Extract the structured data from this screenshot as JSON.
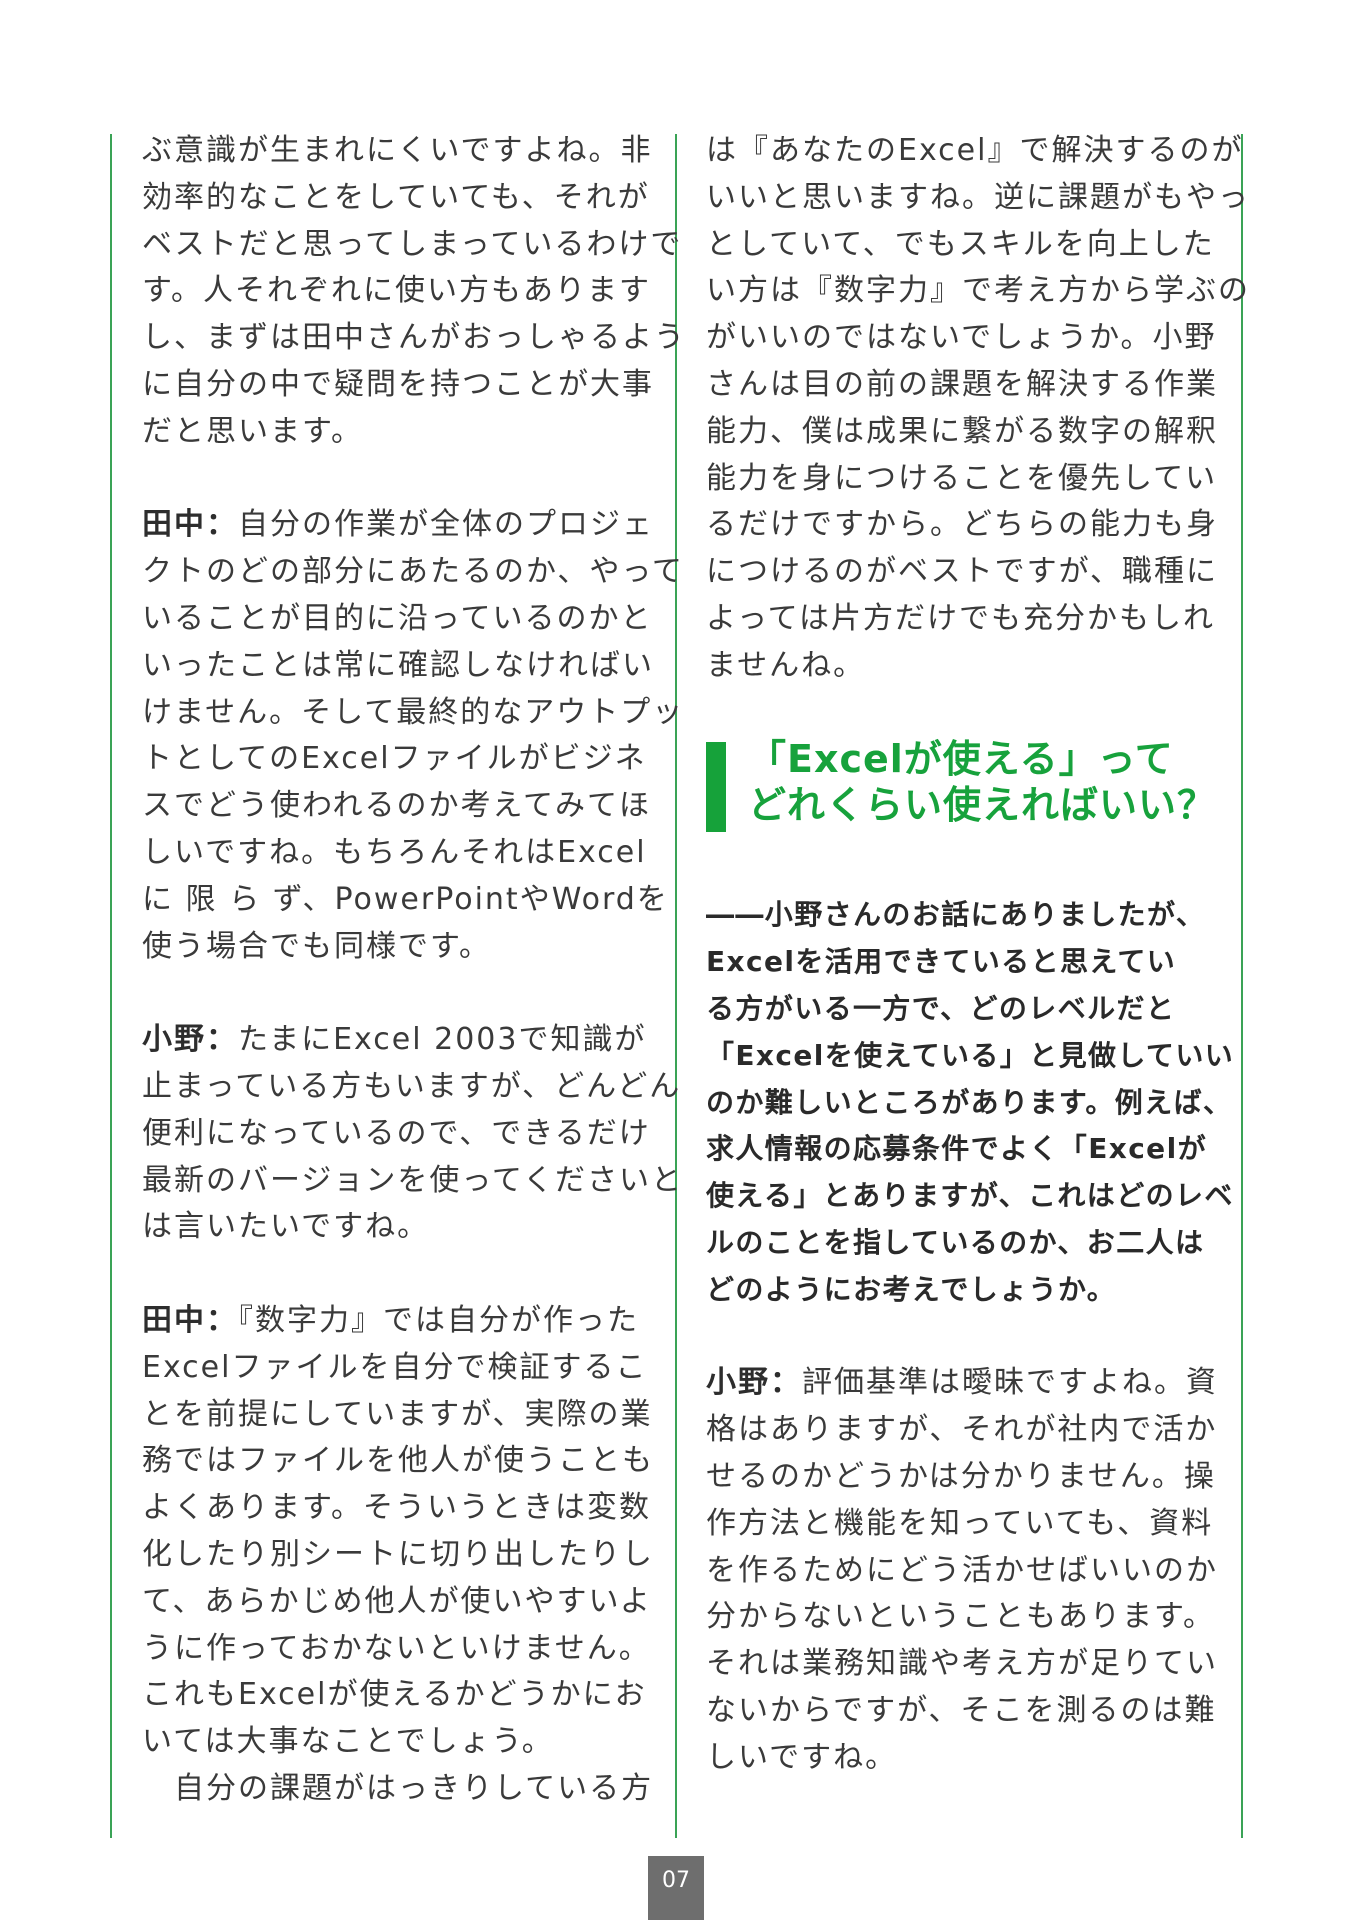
{
  "colors": {
    "accent_green": "#17a23c",
    "rule_green": "#3aa356",
    "page_number_bg": "#6e6e6e"
  },
  "left_column": {
    "p1": [
      "ぶ意識が生まれにくいですよね。非",
      "効率的なことをしていても、それが",
      "ベストだと思ってしまっているわけで",
      "す。人それぞれに使い方もあります",
      "し、まずは田中さんがおっしゃるよう",
      "に自分の中で疑問を持つことが大事",
      "だと思います。"
    ],
    "p2": {
      "speaker": "田中：",
      "first": "自分の作業が全体のプロジェ",
      "lines": [
        "クトのどの部分にあたるのか、やって",
        "いることが目的に沿っているのかと",
        "いったことは常に確認しなければい",
        "けません。そして最終的なアウトプッ",
        "トとしてのExcelファイルがビジネ",
        "スでどう使われるのか考えてみてほ",
        "しいですね。もちろんそれはExcel",
        "に 限 ら ず、PowerPointやWordを",
        "使う場合でも同様です。"
      ]
    },
    "p3": {
      "speaker": "小野：",
      "first": "たまにExcel 2003で知識が",
      "lines": [
        "止まっている方もいますが、どんどん",
        "便利になっているので、できるだけ",
        "最新のバージョンを使ってくださいと",
        "は言いたいですね。"
      ]
    },
    "p4": {
      "speaker": "田中：",
      "first": "『数字力』では自分が作った",
      "lines": [
        "Excelファイルを自分で検証するこ",
        "とを前提にしていますが、実際の業",
        "務ではファイルを他人が使うことも",
        "よくあります。そういうときは変数",
        "化したり別シートに切り出したりし",
        "て、あらかじめ他人が使いやすいよ",
        "うに作っておかないといけません。",
        "これもExcelが使えるかどうかにお",
        "いては大事なことでしょう。",
        "　自分の課題がはっきりしている方"
      ]
    }
  },
  "right_column": {
    "p1": [
      "は『あなたのExcel』で解決するのが",
      "いいと思いますね。逆に課題がもやっ",
      "としていて、でもスキルを向上した",
      "い方は『数字力』で考え方から学ぶの",
      "がいいのではないでしょうか。小野",
      "さんは目の前の課題を解決する作業",
      "能力、僕は成果に繋がる数字の解釈",
      "能力を身につけることを優先してい",
      "るだけですから。どちらの能力も身",
      "につけるのがベストですが、職種に",
      "よっては片方だけでも充分かもしれ",
      "ませんね。"
    ],
    "heading": {
      "line1": "「Excelが使える」って",
      "line2": "どれくらい使えればいい？"
    },
    "question": [
      "――小野さんのお話にありましたが、",
      "Excelを活用できていると思えてい",
      "る方がいる一方で、どのレベルだと",
      "「Excelを使えている」と見做していい",
      "のか難しいところがあります。例えば、",
      "求人情報の応募条件でよく「Excelが",
      "使える」とありますが、これはどのレベ",
      "ルのことを指しているのか、お二人は",
      "どのようにお考えでしょうか。"
    ],
    "p2": {
      "speaker": "小野：",
      "first": "評価基準は曖昧ですよね。資",
      "lines": [
        "格はありますが、それが社内で活か",
        "せるのかどうかは分かりません。操",
        "作方法と機能を知っていても、資料",
        "を作るためにどう活かせばいいのか",
        "分からないということもあります。",
        "それは業務知識や考え方が足りてい",
        "ないからですが、そこを測るのは難",
        "しいですね。"
      ]
    }
  },
  "page_number": "07"
}
